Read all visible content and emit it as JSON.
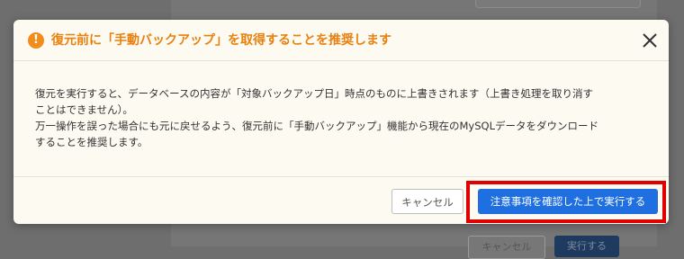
{
  "background": {
    "cancel_label": "キャンセル",
    "execute_label": "実行する"
  },
  "modal": {
    "title": "復元前に「手動バックアップ」を取得することを推奨します",
    "warning_icon": "!",
    "body_lines": [
      "復元を実行すると、データベースの内容が「対象バックアップ日」時点のものに上書きされます（上書き処理を取り消す",
      "ことはできません）。",
      "万一操作を誤った場合にも元に戻せるよう、復元前に「手動バックアップ」機能から現在のMySQLデータをダウンロード",
      "することを推奨します。"
    ],
    "cancel_label": "キャンセル",
    "confirm_label": "注意事項を確認した上で実行する"
  },
  "colors": {
    "title": "#e8810f",
    "accent": "#1f6fe0",
    "highlight": "#e00000",
    "warning": "#f28c1b"
  }
}
